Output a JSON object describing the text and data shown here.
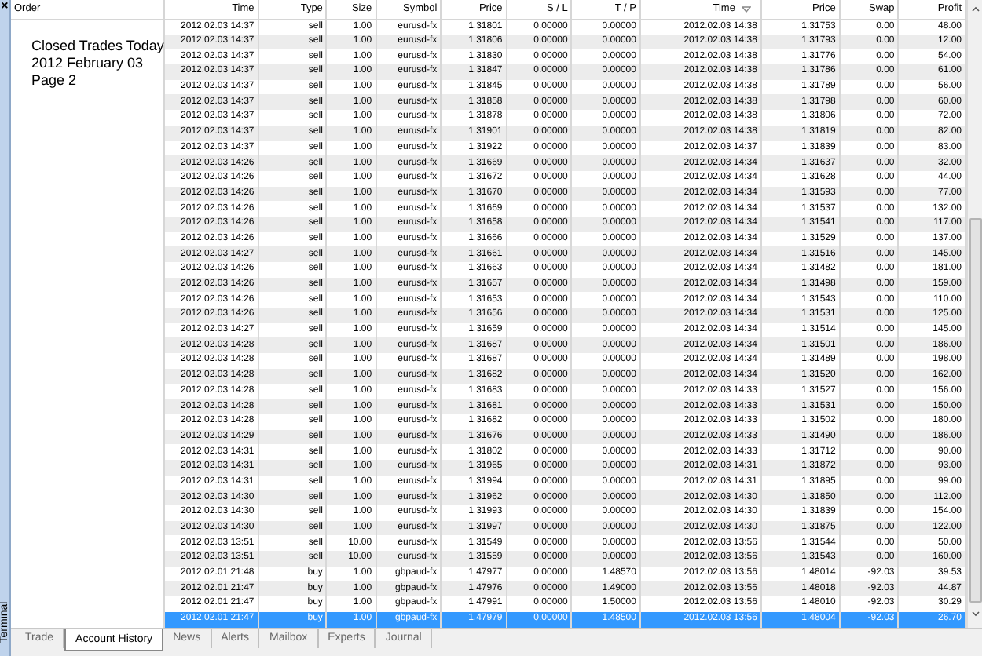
{
  "sidebar": {
    "close": "×",
    "label": "Terminal"
  },
  "note": [
    "Closed Trades Today",
    "2012 February 03",
    "Page 2"
  ],
  "columns": [
    {
      "label": "Order",
      "sorted": false
    },
    {
      "label": "Time",
      "sorted": false
    },
    {
      "label": "Type",
      "sorted": false
    },
    {
      "label": "Size",
      "sorted": false
    },
    {
      "label": "Symbol",
      "sorted": false
    },
    {
      "label": "Price",
      "sorted": false
    },
    {
      "label": "S / L",
      "sorted": false
    },
    {
      "label": "T / P",
      "sorted": false
    },
    {
      "label": "Time",
      "sorted": true
    },
    {
      "label": "Price",
      "sorted": false
    },
    {
      "label": "Swap",
      "sorted": false
    },
    {
      "label": "Profit",
      "sorted": false
    }
  ],
  "rows": [
    {
      "cells": [
        "2012.02.03 14:37",
        "sell",
        "1.00",
        "eurusd-fx",
        "1.31801",
        "0.00000",
        "0.00000",
        "2012.02.03 14:38",
        "1.31753",
        "0.00",
        "48.00"
      ],
      "selected": false
    },
    {
      "cells": [
        "2012.02.03 14:37",
        "sell",
        "1.00",
        "eurusd-fx",
        "1.31806",
        "0.00000",
        "0.00000",
        "2012.02.03 14:38",
        "1.31793",
        "0.00",
        "12.00"
      ],
      "selected": false
    },
    {
      "cells": [
        "2012.02.03 14:37",
        "sell",
        "1.00",
        "eurusd-fx",
        "1.31830",
        "0.00000",
        "0.00000",
        "2012.02.03 14:38",
        "1.31776",
        "0.00",
        "54.00"
      ],
      "selected": false
    },
    {
      "cells": [
        "2012.02.03 14:37",
        "sell",
        "1.00",
        "eurusd-fx",
        "1.31847",
        "0.00000",
        "0.00000",
        "2012.02.03 14:38",
        "1.31786",
        "0.00",
        "61.00"
      ],
      "selected": false
    },
    {
      "cells": [
        "2012.02.03 14:37",
        "sell",
        "1.00",
        "eurusd-fx",
        "1.31845",
        "0.00000",
        "0.00000",
        "2012.02.03 14:38",
        "1.31789",
        "0.00",
        "56.00"
      ],
      "selected": false
    },
    {
      "cells": [
        "2012.02.03 14:37",
        "sell",
        "1.00",
        "eurusd-fx",
        "1.31858",
        "0.00000",
        "0.00000",
        "2012.02.03 14:38",
        "1.31798",
        "0.00",
        "60.00"
      ],
      "selected": false
    },
    {
      "cells": [
        "2012.02.03 14:37",
        "sell",
        "1.00",
        "eurusd-fx",
        "1.31878",
        "0.00000",
        "0.00000",
        "2012.02.03 14:38",
        "1.31806",
        "0.00",
        "72.00"
      ],
      "selected": false
    },
    {
      "cells": [
        "2012.02.03 14:37",
        "sell",
        "1.00",
        "eurusd-fx",
        "1.31901",
        "0.00000",
        "0.00000",
        "2012.02.03 14:38",
        "1.31819",
        "0.00",
        "82.00"
      ],
      "selected": false
    },
    {
      "cells": [
        "2012.02.03 14:37",
        "sell",
        "1.00",
        "eurusd-fx",
        "1.31922",
        "0.00000",
        "0.00000",
        "2012.02.03 14:37",
        "1.31839",
        "0.00",
        "83.00"
      ],
      "selected": false
    },
    {
      "cells": [
        "2012.02.03 14:26",
        "sell",
        "1.00",
        "eurusd-fx",
        "1.31669",
        "0.00000",
        "0.00000",
        "2012.02.03 14:34",
        "1.31637",
        "0.00",
        "32.00"
      ],
      "selected": false
    },
    {
      "cells": [
        "2012.02.03 14:26",
        "sell",
        "1.00",
        "eurusd-fx",
        "1.31672",
        "0.00000",
        "0.00000",
        "2012.02.03 14:34",
        "1.31628",
        "0.00",
        "44.00"
      ],
      "selected": false
    },
    {
      "cells": [
        "2012.02.03 14:26",
        "sell",
        "1.00",
        "eurusd-fx",
        "1.31670",
        "0.00000",
        "0.00000",
        "2012.02.03 14:34",
        "1.31593",
        "0.00",
        "77.00"
      ],
      "selected": false
    },
    {
      "cells": [
        "2012.02.03 14:26",
        "sell",
        "1.00",
        "eurusd-fx",
        "1.31669",
        "0.00000",
        "0.00000",
        "2012.02.03 14:34",
        "1.31537",
        "0.00",
        "132.00"
      ],
      "selected": false
    },
    {
      "cells": [
        "2012.02.03 14:26",
        "sell",
        "1.00",
        "eurusd-fx",
        "1.31658",
        "0.00000",
        "0.00000",
        "2012.02.03 14:34",
        "1.31541",
        "0.00",
        "117.00"
      ],
      "selected": false
    },
    {
      "cells": [
        "2012.02.03 14:26",
        "sell",
        "1.00",
        "eurusd-fx",
        "1.31666",
        "0.00000",
        "0.00000",
        "2012.02.03 14:34",
        "1.31529",
        "0.00",
        "137.00"
      ],
      "selected": false
    },
    {
      "cells": [
        "2012.02.03 14:27",
        "sell",
        "1.00",
        "eurusd-fx",
        "1.31661",
        "0.00000",
        "0.00000",
        "2012.02.03 14:34",
        "1.31516",
        "0.00",
        "145.00"
      ],
      "selected": false
    },
    {
      "cells": [
        "2012.02.03 14:26",
        "sell",
        "1.00",
        "eurusd-fx",
        "1.31663",
        "0.00000",
        "0.00000",
        "2012.02.03 14:34",
        "1.31482",
        "0.00",
        "181.00"
      ],
      "selected": false
    },
    {
      "cells": [
        "2012.02.03 14:26",
        "sell",
        "1.00",
        "eurusd-fx",
        "1.31657",
        "0.00000",
        "0.00000",
        "2012.02.03 14:34",
        "1.31498",
        "0.00",
        "159.00"
      ],
      "selected": false
    },
    {
      "cells": [
        "2012.02.03 14:26",
        "sell",
        "1.00",
        "eurusd-fx",
        "1.31653",
        "0.00000",
        "0.00000",
        "2012.02.03 14:34",
        "1.31543",
        "0.00",
        "110.00"
      ],
      "selected": false
    },
    {
      "cells": [
        "2012.02.03 14:26",
        "sell",
        "1.00",
        "eurusd-fx",
        "1.31656",
        "0.00000",
        "0.00000",
        "2012.02.03 14:34",
        "1.31531",
        "0.00",
        "125.00"
      ],
      "selected": false
    },
    {
      "cells": [
        "2012.02.03 14:27",
        "sell",
        "1.00",
        "eurusd-fx",
        "1.31659",
        "0.00000",
        "0.00000",
        "2012.02.03 14:34",
        "1.31514",
        "0.00",
        "145.00"
      ],
      "selected": false
    },
    {
      "cells": [
        "2012.02.03 14:28",
        "sell",
        "1.00",
        "eurusd-fx",
        "1.31687",
        "0.00000",
        "0.00000",
        "2012.02.03 14:34",
        "1.31501",
        "0.00",
        "186.00"
      ],
      "selected": false
    },
    {
      "cells": [
        "2012.02.03 14:28",
        "sell",
        "1.00",
        "eurusd-fx",
        "1.31687",
        "0.00000",
        "0.00000",
        "2012.02.03 14:34",
        "1.31489",
        "0.00",
        "198.00"
      ],
      "selected": false
    },
    {
      "cells": [
        "2012.02.03 14:28",
        "sell",
        "1.00",
        "eurusd-fx",
        "1.31682",
        "0.00000",
        "0.00000",
        "2012.02.03 14:34",
        "1.31520",
        "0.00",
        "162.00"
      ],
      "selected": false
    },
    {
      "cells": [
        "2012.02.03 14:28",
        "sell",
        "1.00",
        "eurusd-fx",
        "1.31683",
        "0.00000",
        "0.00000",
        "2012.02.03 14:33",
        "1.31527",
        "0.00",
        "156.00"
      ],
      "selected": false
    },
    {
      "cells": [
        "2012.02.03 14:28",
        "sell",
        "1.00",
        "eurusd-fx",
        "1.31681",
        "0.00000",
        "0.00000",
        "2012.02.03 14:33",
        "1.31531",
        "0.00",
        "150.00"
      ],
      "selected": false
    },
    {
      "cells": [
        "2012.02.03 14:28",
        "sell",
        "1.00",
        "eurusd-fx",
        "1.31682",
        "0.00000",
        "0.00000",
        "2012.02.03 14:33",
        "1.31502",
        "0.00",
        "180.00"
      ],
      "selected": false
    },
    {
      "cells": [
        "2012.02.03 14:29",
        "sell",
        "1.00",
        "eurusd-fx",
        "1.31676",
        "0.00000",
        "0.00000",
        "2012.02.03 14:33",
        "1.31490",
        "0.00",
        "186.00"
      ],
      "selected": false
    },
    {
      "cells": [
        "2012.02.03 14:31",
        "sell",
        "1.00",
        "eurusd-fx",
        "1.31802",
        "0.00000",
        "0.00000",
        "2012.02.03 14:33",
        "1.31712",
        "0.00",
        "90.00"
      ],
      "selected": false
    },
    {
      "cells": [
        "2012.02.03 14:31",
        "sell",
        "1.00",
        "eurusd-fx",
        "1.31965",
        "0.00000",
        "0.00000",
        "2012.02.03 14:31",
        "1.31872",
        "0.00",
        "93.00"
      ],
      "selected": false
    },
    {
      "cells": [
        "2012.02.03 14:31",
        "sell",
        "1.00",
        "eurusd-fx",
        "1.31994",
        "0.00000",
        "0.00000",
        "2012.02.03 14:31",
        "1.31895",
        "0.00",
        "99.00"
      ],
      "selected": false
    },
    {
      "cells": [
        "2012.02.03 14:30",
        "sell",
        "1.00",
        "eurusd-fx",
        "1.31962",
        "0.00000",
        "0.00000",
        "2012.02.03 14:30",
        "1.31850",
        "0.00",
        "112.00"
      ],
      "selected": false
    },
    {
      "cells": [
        "2012.02.03 14:30",
        "sell",
        "1.00",
        "eurusd-fx",
        "1.31993",
        "0.00000",
        "0.00000",
        "2012.02.03 14:30",
        "1.31839",
        "0.00",
        "154.00"
      ],
      "selected": false
    },
    {
      "cells": [
        "2012.02.03 14:30",
        "sell",
        "1.00",
        "eurusd-fx",
        "1.31997",
        "0.00000",
        "0.00000",
        "2012.02.03 14:30",
        "1.31875",
        "0.00",
        "122.00"
      ],
      "selected": false
    },
    {
      "cells": [
        "2012.02.03 13:51",
        "sell",
        "10.00",
        "eurusd-fx",
        "1.31549",
        "0.00000",
        "0.00000",
        "2012.02.03 13:56",
        "1.31544",
        "0.00",
        "50.00"
      ],
      "selected": false
    },
    {
      "cells": [
        "2012.02.03 13:51",
        "sell",
        "10.00",
        "eurusd-fx",
        "1.31559",
        "0.00000",
        "0.00000",
        "2012.02.03 13:56",
        "1.31543",
        "0.00",
        "160.00"
      ],
      "selected": false
    },
    {
      "cells": [
        "2012.02.01 21:48",
        "buy",
        "1.00",
        "gbpaud-fx",
        "1.47977",
        "0.00000",
        "1.48570",
        "2012.02.03 13:56",
        "1.48014",
        "-92.03",
        "39.53"
      ],
      "selected": false
    },
    {
      "cells": [
        "2012.02.01 21:47",
        "buy",
        "1.00",
        "gbpaud-fx",
        "1.47976",
        "0.00000",
        "1.49000",
        "2012.02.03 13:56",
        "1.48018",
        "-92.03",
        "44.87"
      ],
      "selected": false
    },
    {
      "cells": [
        "2012.02.01 21:47",
        "buy",
        "1.00",
        "gbpaud-fx",
        "1.47991",
        "0.00000",
        "1.50000",
        "2012.02.03 13:56",
        "1.48010",
        "-92.03",
        "30.29"
      ],
      "selected": false
    },
    {
      "cells": [
        "2012.02.01 21:47",
        "buy",
        "1.00",
        "gbpaud-fx",
        "1.47979",
        "0.00000",
        "1.48500",
        "2012.02.03 13:56",
        "1.48004",
        "-92.03",
        "26.70"
      ],
      "selected": true
    }
  ],
  "tabs": [
    {
      "label": "Trade",
      "selected": false
    },
    {
      "label": "Account History",
      "selected": true
    },
    {
      "label": "News",
      "selected": false
    },
    {
      "label": "Alerts",
      "selected": false
    },
    {
      "label": "Mailbox",
      "selected": false
    },
    {
      "label": "Experts",
      "selected": false
    },
    {
      "label": "Journal",
      "selected": false
    }
  ]
}
